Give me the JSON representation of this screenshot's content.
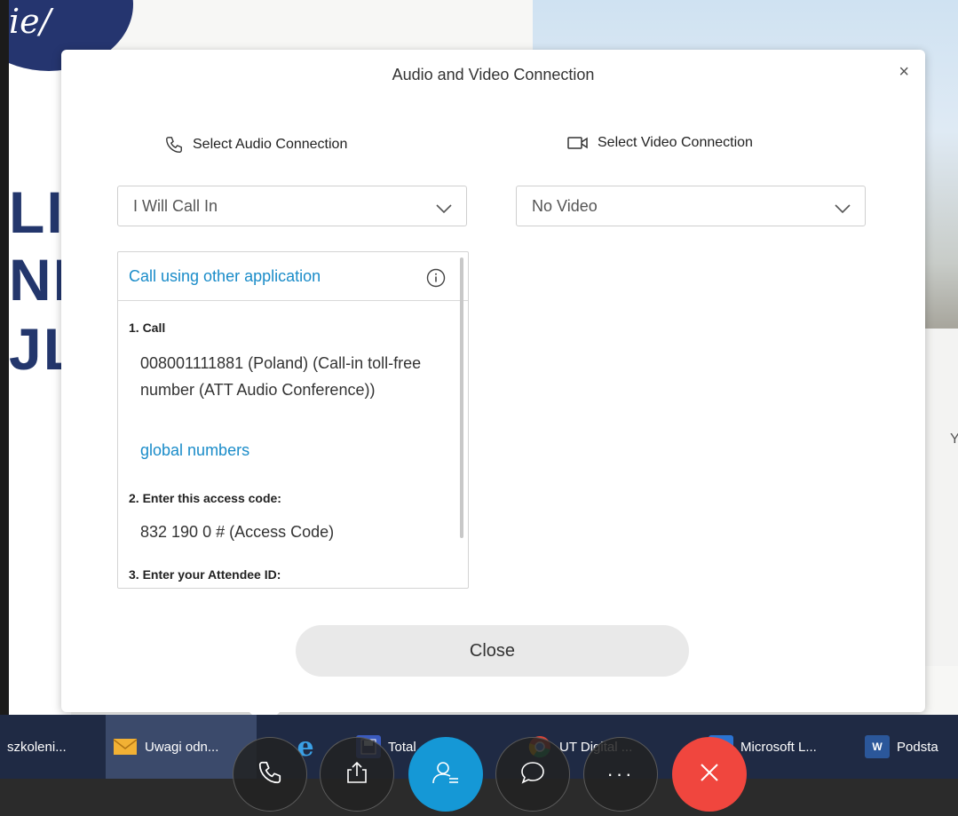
{
  "dialog": {
    "title": "Audio and Video Connection",
    "close_x": "×",
    "close_button": "Close"
  },
  "audio": {
    "heading": "Select Audio Connection",
    "selected": "I Will Call In",
    "icon": "phone-icon"
  },
  "video": {
    "heading": "Select Video Connection",
    "selected": "No Video",
    "icon": "camera-icon"
  },
  "call_panel": {
    "link": "Call using other application",
    "step1_label": "1. Call",
    "step1_text": "008001111881  (Poland) (Call-in toll-free number (ATT Audio Conference))",
    "global_numbers": "global numbers",
    "step2_label": "2. Enter this access code:",
    "step2_text": "832 190 0 # (Access Code)",
    "step3_label": "3. Enter your Attendee ID:"
  },
  "background": {
    "logo_text": "ie/",
    "lines": [
      "LI",
      "NI",
      "JL"
    ],
    "edge_letter": "Y"
  },
  "taskbar": {
    "items": [
      {
        "label": "szkoleni..."
      },
      {
        "label": "Uwagi odn..."
      },
      {
        "label": "e"
      },
      {
        "label": "Total...n..."
      },
      {
        "label": "UT Digital ..."
      },
      {
        "label": "Microsoft L..."
      },
      {
        "label": "Podsta"
      }
    ]
  },
  "controls": {
    "more": "···"
  },
  "colors": {
    "accent": "#1598d6",
    "link": "#1a8cc9",
    "end": "#f0463e",
    "taskbar": "#1f2a44"
  }
}
